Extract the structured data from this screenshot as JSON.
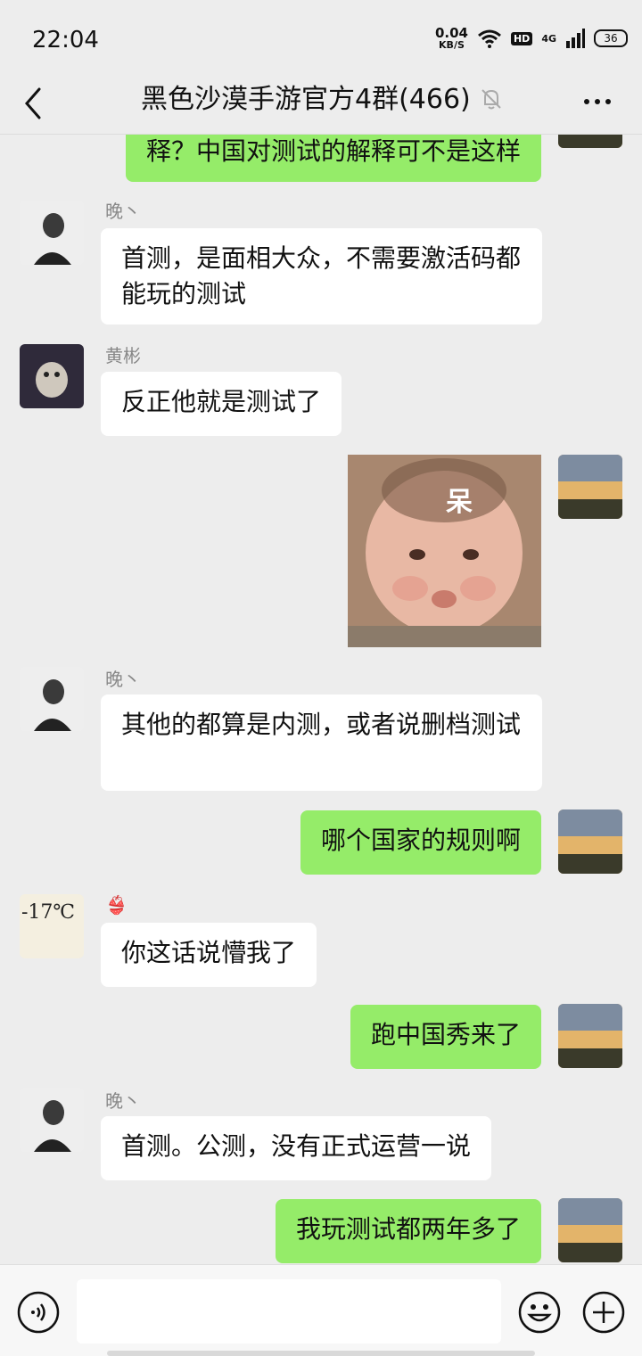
{
  "status": {
    "time": "22:04",
    "net_speed": "0.04",
    "net_unit": "KB/S",
    "hd": "HD",
    "network": "4G",
    "battery": "36"
  },
  "header": {
    "title": "黑色沙漠手游官方4群(466)"
  },
  "messages": [
    {
      "text": "释？中国对测试的解释可不是这样"
    },
    {
      "sender": "晚丶",
      "text": "首测，是面相大众，不需要激活码都能玩的测试"
    },
    {
      "sender": "黄彬",
      "text": "反正他就是测试了"
    },
    {
      "sticker_text": "呆"
    },
    {
      "sender": "晚丶",
      "text": "其他的都算是内测，或者说删档测试"
    },
    {
      "text": "哪个国家的规则啊"
    },
    {
      "sender": "👙",
      "avatar_text": "-17℃",
      "text": "你这话说懵我了"
    },
    {
      "text": "跑中国秀来了"
    },
    {
      "sender": "晚丶",
      "text": "首测。公测，没有正式运营一说"
    },
    {
      "text": "我玩测试都两年多了"
    }
  ],
  "colors": {
    "background": "#ededed",
    "outgoing_bubble": "#95ec69",
    "incoming_bubble": "#ffffff"
  }
}
